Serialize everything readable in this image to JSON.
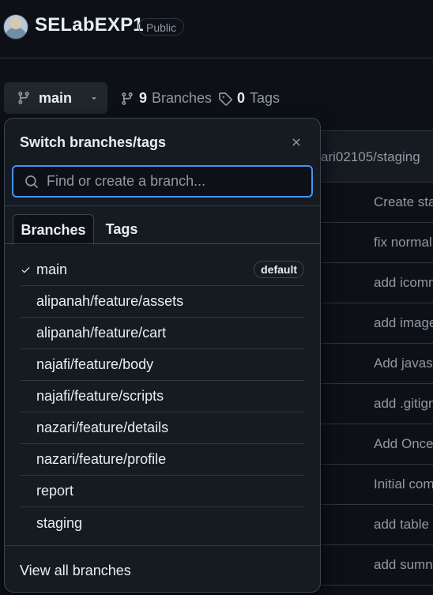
{
  "repo": {
    "name": "SELabEXP1",
    "visibility": "Public"
  },
  "branch_selector": {
    "current": "main"
  },
  "counts": {
    "branches_number": "9",
    "branches_label": "Branches",
    "tags_number": "0",
    "tags_label": "Tags"
  },
  "background_table": {
    "header_text": "ari02105/staging",
    "rows": [
      "Create sta",
      "fix normal",
      "add icomn",
      "add image",
      "Add javas",
      "add .gitign",
      "Add Once",
      "Initial com",
      "add table",
      "add sumn"
    ]
  },
  "dropdown": {
    "title": "Switch branches/tags",
    "search_placeholder": "Find or create a branch...",
    "tabs": {
      "branches": "Branches",
      "tags": "Tags"
    },
    "branches": [
      {
        "name": "main",
        "selected": true,
        "badge": "default"
      },
      {
        "name": "alipanah/feature/assets"
      },
      {
        "name": "alipanah/feature/cart"
      },
      {
        "name": "najafi/feature/body"
      },
      {
        "name": "najafi/feature/scripts"
      },
      {
        "name": "nazari/feature/details"
      },
      {
        "name": "nazari/feature/profile"
      },
      {
        "name": "report"
      },
      {
        "name": "staging"
      }
    ],
    "footer_link": "View all branches"
  },
  "icons": {
    "branch": "git-branch-icon",
    "tag": "tag-icon",
    "search": "search-icon",
    "close": "close-icon",
    "check": "check-icon",
    "caret": "triangle-down-icon"
  },
  "colors": {
    "background": "#0d1117",
    "surface": "#161b22",
    "border": "#30363d",
    "focus": "#4493f8",
    "text": "#e6edf3",
    "muted": "#9198a1"
  }
}
